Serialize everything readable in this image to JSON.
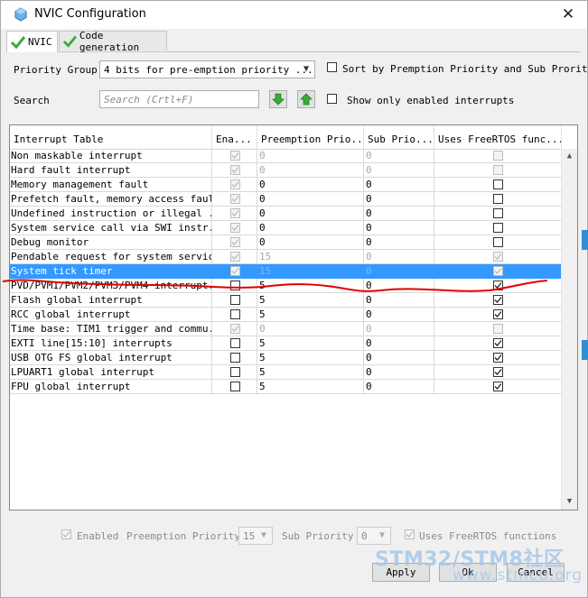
{
  "window": {
    "title": "NVIC Configuration",
    "close_symbol": "✕"
  },
  "tabs": [
    {
      "label": "NVIC",
      "active": true
    },
    {
      "label": "Code generation",
      "active": false
    }
  ],
  "priority_group": {
    "label": "Priority Group",
    "value": "4 bits for pre-emption priority ..."
  },
  "sort_option": {
    "label": "Sort by Premption Priority and Sub Prority",
    "checked": false
  },
  "search": {
    "label": "Search",
    "placeholder": "Search (Crtl+F)"
  },
  "show_enabled": {
    "label": "Show only enabled interrupts",
    "checked": false
  },
  "table": {
    "columns": [
      "Interrupt Table",
      "Ena...",
      "Preemption Prio...",
      "Sub Prio...",
      "Uses FreeRTOS func..."
    ],
    "rows": [
      {
        "name": "Non maskable interrupt",
        "enabled": true,
        "enabled_locked": true,
        "preemption": "0",
        "sub": "0",
        "rtos": false,
        "rtos_locked": true,
        "prio_gray": true,
        "selected": false
      },
      {
        "name": "Hard fault interrupt",
        "enabled": true,
        "enabled_locked": true,
        "preemption": "0",
        "sub": "0",
        "rtos": false,
        "rtos_locked": true,
        "prio_gray": true,
        "selected": false
      },
      {
        "name": "Memory management fault",
        "enabled": true,
        "enabled_locked": true,
        "preemption": "0",
        "sub": "0",
        "rtos": false,
        "rtos_locked": false,
        "prio_gray": false,
        "selected": false
      },
      {
        "name": "Prefetch fault, memory access fault",
        "enabled": true,
        "enabled_locked": true,
        "preemption": "0",
        "sub": "0",
        "rtos": false,
        "rtos_locked": false,
        "prio_gray": false,
        "selected": false
      },
      {
        "name": "Undefined instruction or illegal ...",
        "enabled": true,
        "enabled_locked": true,
        "preemption": "0",
        "sub": "0",
        "rtos": false,
        "rtos_locked": false,
        "prio_gray": false,
        "selected": false
      },
      {
        "name": "System service call via SWI instr...",
        "enabled": true,
        "enabled_locked": true,
        "preemption": "0",
        "sub": "0",
        "rtos": false,
        "rtos_locked": false,
        "prio_gray": false,
        "selected": false
      },
      {
        "name": "Debug monitor",
        "enabled": true,
        "enabled_locked": true,
        "preemption": "0",
        "sub": "0",
        "rtos": false,
        "rtos_locked": false,
        "prio_gray": false,
        "selected": false
      },
      {
        "name": "Pendable request for system service",
        "enabled": true,
        "enabled_locked": true,
        "preemption": "15",
        "sub": "0",
        "rtos": true,
        "rtos_locked": true,
        "prio_gray": true,
        "selected": false
      },
      {
        "name": "System tick timer",
        "enabled": true,
        "enabled_locked": true,
        "preemption": "15",
        "sub": "0",
        "rtos": true,
        "rtos_locked": true,
        "prio_gray": true,
        "selected": true
      },
      {
        "name": "PVD/PVM1/PVM2/PVM3/PVM4 interrupt...",
        "enabled": false,
        "enabled_locked": false,
        "preemption": "5",
        "sub": "0",
        "rtos": true,
        "rtos_locked": false,
        "prio_gray": false,
        "selected": false
      },
      {
        "name": "Flash global interrupt",
        "enabled": false,
        "enabled_locked": false,
        "preemption": "5",
        "sub": "0",
        "rtos": true,
        "rtos_locked": false,
        "prio_gray": false,
        "selected": false
      },
      {
        "name": "RCC global interrupt",
        "enabled": false,
        "enabled_locked": false,
        "preemption": "5",
        "sub": "0",
        "rtos": true,
        "rtos_locked": false,
        "prio_gray": false,
        "selected": false
      },
      {
        "name": "Time base: TIM1 trigger and commu...",
        "enabled": true,
        "enabled_locked": true,
        "preemption": "0",
        "sub": "0",
        "rtos": false,
        "rtos_locked": true,
        "prio_gray": true,
        "selected": false
      },
      {
        "name": "EXTI line[15:10] interrupts",
        "enabled": false,
        "enabled_locked": false,
        "preemption": "5",
        "sub": "0",
        "rtos": true,
        "rtos_locked": false,
        "prio_gray": false,
        "selected": false
      },
      {
        "name": "USB OTG FS global interrupt",
        "enabled": false,
        "enabled_locked": false,
        "preemption": "5",
        "sub": "0",
        "rtos": true,
        "rtos_locked": false,
        "prio_gray": false,
        "selected": false
      },
      {
        "name": "LPUART1 global interrupt",
        "enabled": false,
        "enabled_locked": false,
        "preemption": "5",
        "sub": "0",
        "rtos": true,
        "rtos_locked": false,
        "prio_gray": false,
        "selected": false
      },
      {
        "name": "FPU global interrupt",
        "enabled": false,
        "enabled_locked": false,
        "preemption": "5",
        "sub": "0",
        "rtos": true,
        "rtos_locked": false,
        "prio_gray": false,
        "selected": false
      }
    ]
  },
  "bottom": {
    "enabled_label": "Enabled",
    "preemption_label": "Preemption Priority",
    "preemption_value": "15",
    "sub_label": "Sub Priority",
    "sub_value": "0",
    "rtos_label": "Uses FreeRTOS functions"
  },
  "buttons": {
    "apply": "Apply",
    "ok": "Ok",
    "cancel": "Cancel"
  },
  "watermark": {
    "line1": "STM32/STM8社区",
    "line2": "www.stmcu.org"
  },
  "colors": {
    "selection": "#3399ff",
    "annotation": "#e00000",
    "check_green": "#3ea93e",
    "arrow_green": "#3ea93e"
  }
}
